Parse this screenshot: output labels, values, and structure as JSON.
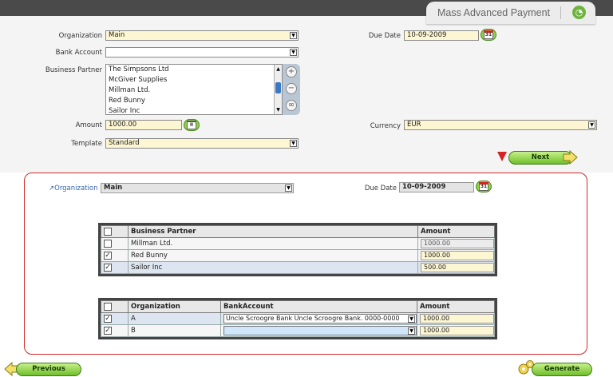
{
  "app": {
    "window_title": "Mass Advanced Payment"
  },
  "header": {
    "organization": {
      "label": "Organization",
      "value": "Main"
    },
    "bank_account": {
      "label": "Bank Account",
      "value": ""
    },
    "business_partner": {
      "label": "Business Partner",
      "options": [
        "The Simpsons Ltd",
        "McGiver Supplies",
        "Millman Ltd.",
        "Red Bunny",
        "Sailor Inc"
      ]
    },
    "amount": {
      "label": "Amount",
      "value": "1000.00"
    },
    "template": {
      "label": "Template",
      "value": "Standard"
    },
    "due_date": {
      "label": "Due Date",
      "value": "10-09-2009"
    },
    "currency": {
      "label": "Currency",
      "value": "EUR"
    },
    "calendar_icon_text": "31",
    "next_label": "Next"
  },
  "panel": {
    "organization": {
      "label": "Organization",
      "value": "Main"
    },
    "due_date": {
      "label": "Due Date",
      "value": "10-09-2009"
    },
    "partners_table": {
      "headers": [
        "Business Partner",
        "Amount"
      ],
      "rows": [
        {
          "checked": false,
          "partner": "Millman Ltd.",
          "amount": "1000.00"
        },
        {
          "checked": true,
          "partner": "Red Bunny",
          "amount": "1000.00"
        },
        {
          "checked": true,
          "partner": "Sailor Inc",
          "amount": "500.00"
        }
      ]
    },
    "org_table": {
      "headers": [
        "Organization",
        "BankAccount",
        "Amount"
      ],
      "rows": [
        {
          "checked": true,
          "organization": "A",
          "bank_account": "Uncle Scroogre Bank Uncle Scroogre Bank. 0000-0000",
          "amount": "1000.00"
        },
        {
          "checked": true,
          "organization": "B",
          "bank_account": "",
          "amount": "1000.00"
        }
      ]
    }
  },
  "footer": {
    "previous_label": "Previous",
    "generate_label": "Generate"
  },
  "colors": {
    "accent_green": "#6fbf2a",
    "panel_border": "#cc2a2a",
    "field_yellow": "#fdf6d2"
  }
}
